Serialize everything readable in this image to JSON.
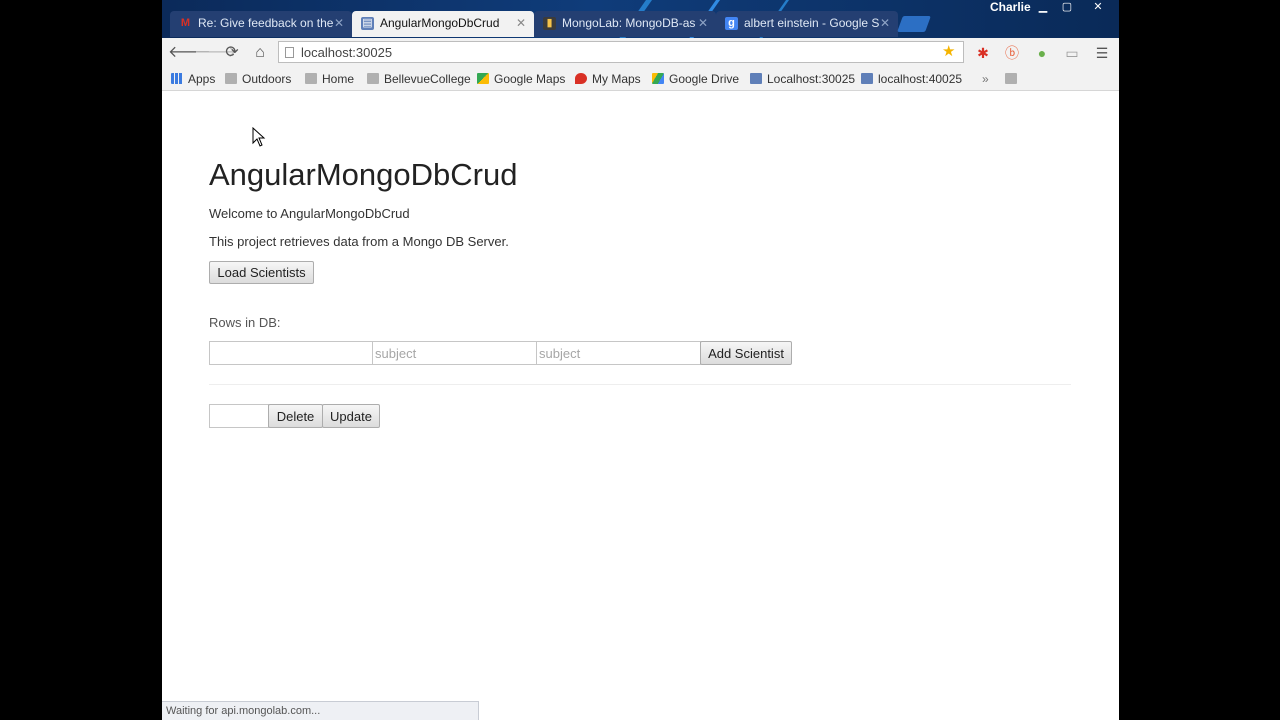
{
  "browser": {
    "tabs": [
      {
        "title": "Re: Give feedback on the",
        "icon": "gmail-icon",
        "color": "#d93025",
        "active": false
      },
      {
        "title": "AngularMongoDbCrud",
        "icon": "page-icon",
        "color": "#5f7fb8",
        "active": true
      },
      {
        "title": "MongoLab: MongoDB-as",
        "icon": "mongolab-icon",
        "color": "#3b3b3b",
        "active": false
      },
      {
        "title": "albert einstein - Google S",
        "icon": "google-icon",
        "color": "#4285f4",
        "active": false
      }
    ],
    "user": "Charlie",
    "address": "localhost:30025",
    "bookmarks": [
      {
        "label": "Apps",
        "icon": "apps-grid-icon"
      },
      {
        "label": "Outdoors",
        "icon": "folder-icon"
      },
      {
        "label": "Home",
        "icon": "folder-icon"
      },
      {
        "label": "BellevueCollege",
        "icon": "folder-icon"
      },
      {
        "label": "Google Maps",
        "icon": "maps-icon"
      },
      {
        "label": "My Maps",
        "icon": "map-pin-icon"
      },
      {
        "label": "Google Drive",
        "icon": "drive-icon"
      },
      {
        "label": "Localhost:30025",
        "icon": "page-icon"
      },
      {
        "label": "localhost:40025",
        "icon": "page-icon"
      }
    ],
    "status_text": "Waiting for api.mongolab.com..."
  },
  "page": {
    "title": "AngularMongoDbCrud",
    "welcome": "Welcome to AngularMongoDbCrud",
    "description": "This project retrieves data from a Mongo DB Server.",
    "load_button": "Load Scientists",
    "rows_label": "Rows in DB:",
    "name_input": {
      "value": "",
      "placeholder": ""
    },
    "subject_input_1": {
      "value": "",
      "placeholder": "subject"
    },
    "subject_input_2": {
      "value": "",
      "placeholder": "subject"
    },
    "add_button": "Add Scientist",
    "id_input": {
      "value": "",
      "placeholder": ""
    },
    "delete_button": "Delete",
    "update_button": "Update"
  }
}
